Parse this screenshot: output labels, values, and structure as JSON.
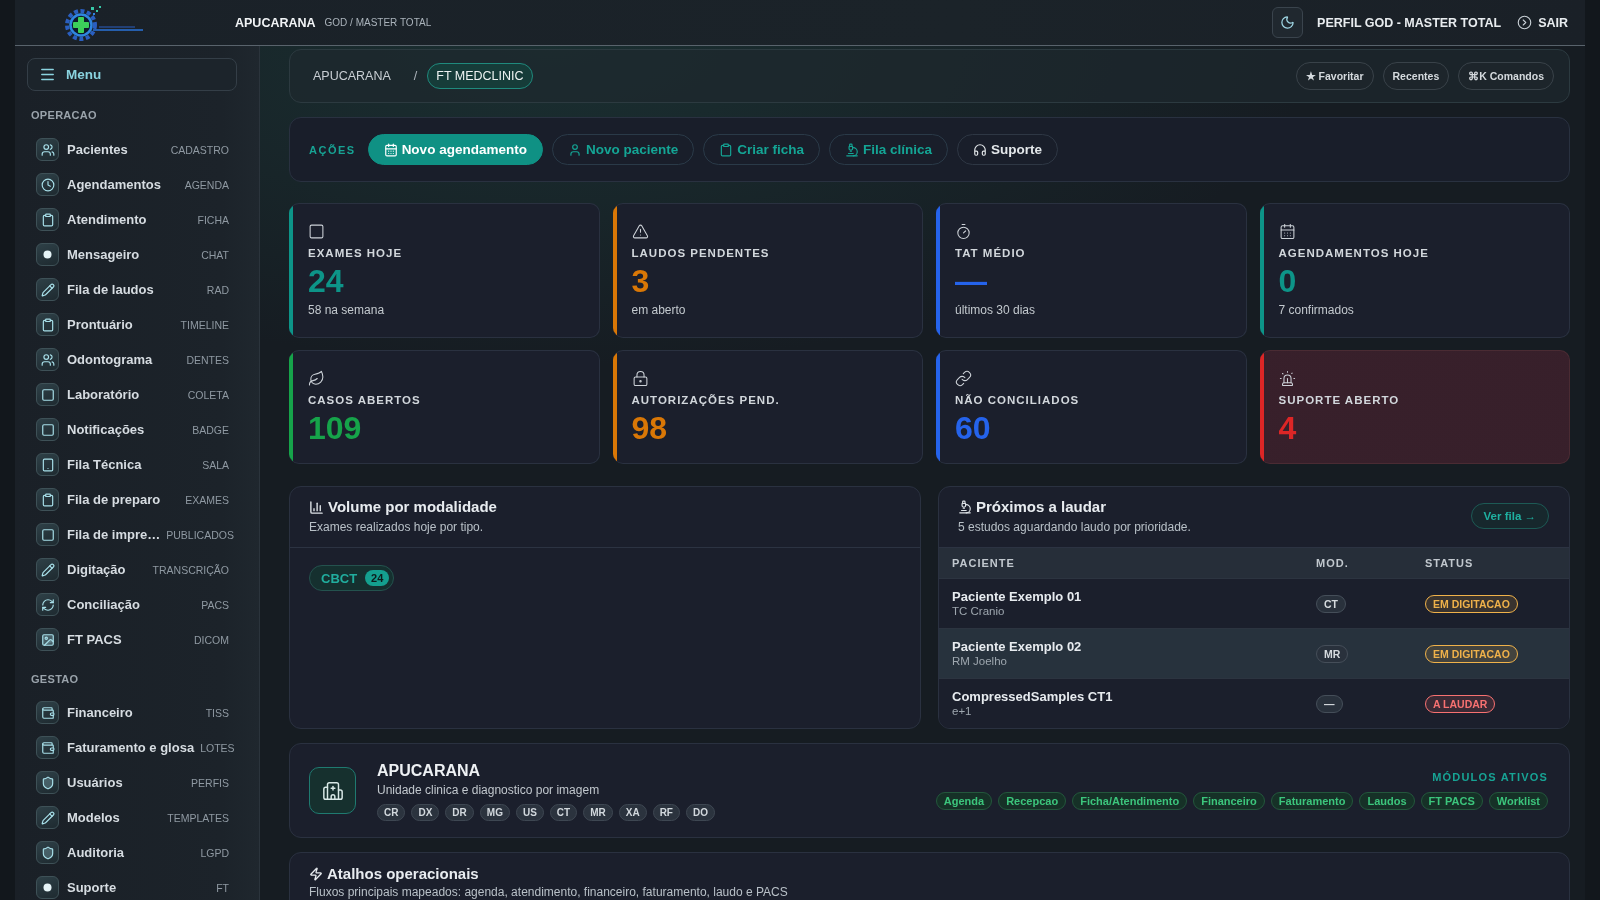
{
  "topbar": {
    "unit": "APUCARANA",
    "profile_path": "GOD / MASTER TOTAL",
    "profile": "PERFIL GOD - MASTER TOTAL",
    "logout": "SAIR"
  },
  "sidebar": {
    "menu": "Menu",
    "sections": [
      {
        "title": "OPERACAO",
        "items": [
          {
            "label": "Pacientes",
            "tag": "CADASTRO",
            "kind": "users"
          },
          {
            "label": "Agendamentos",
            "tag": "AGENDA",
            "kind": "clock"
          },
          {
            "label": "Atendimento",
            "tag": "FICHA",
            "kind": "clipboard"
          },
          {
            "label": "Mensageiro",
            "tag": "CHAT",
            "kind": "dot"
          },
          {
            "label": "Fila de laudos",
            "tag": "RAD",
            "kind": "pencil"
          },
          {
            "label": "Prontuário",
            "tag": "TIMELINE",
            "kind": "clipboard"
          },
          {
            "label": "Odontograma",
            "tag": "DENTES",
            "kind": "users"
          },
          {
            "label": "Laboratório",
            "tag": "COLETA",
            "kind": "square"
          },
          {
            "label": "Notificações",
            "tag": "BADGE",
            "kind": "square"
          },
          {
            "label": "Fila Técnica",
            "tag": "SALA",
            "kind": "tablet"
          },
          {
            "label": "Fila de preparo",
            "tag": "EXAMES",
            "kind": "clipboard"
          },
          {
            "label": "Fila de impre…",
            "tag": "PUBLICADOS",
            "kind": "square"
          },
          {
            "label": "Digitação",
            "tag": "TRANSCRIÇÃO",
            "kind": "pencil"
          },
          {
            "label": "Conciliação",
            "tag": "PACS",
            "kind": "refresh"
          },
          {
            "label": "FT PACS",
            "tag": "DICOM",
            "kind": "image"
          }
        ]
      },
      {
        "title": "GESTAO",
        "items": [
          {
            "label": "Financeiro",
            "tag": "TISS",
            "kind": "wallet"
          },
          {
            "label": "Faturamento e glosa",
            "tag": "LOTES",
            "kind": "wallet"
          },
          {
            "label": "Usuários",
            "tag": "PERFIS",
            "kind": "shield"
          },
          {
            "label": "Modelos",
            "tag": "TEMPLATES",
            "kind": "pencil"
          },
          {
            "label": "Auditoria",
            "tag": "LGPD",
            "kind": "shield"
          },
          {
            "label": "Suporte",
            "tag": "FT",
            "kind": "dot"
          }
        ]
      }
    ]
  },
  "breadcrumb": {
    "separator": "/",
    "items": [
      {
        "label": "APUCARANA",
        "selected": false
      },
      {
        "label": "FT MEDCLINIC",
        "selected": true
      }
    ]
  },
  "quick_buttons": [
    "★ Favoritar",
    "Recentes",
    "⌘K Comandos"
  ],
  "actions": {
    "label": "AÇÕES",
    "buttons": [
      {
        "label": "Novo agendamento",
        "kind": "primary"
      },
      {
        "label": "Novo paciente",
        "kind": "outline"
      },
      {
        "label": "Criar ficha",
        "kind": "outline"
      },
      {
        "label": "Fila clínica",
        "kind": "outline"
      },
      {
        "label": "Suporte",
        "kind": "plain"
      }
    ]
  },
  "stats": [
    {
      "label": "EXAMES HOJE",
      "value": "24",
      "note": "58 na semana",
      "kind": "square",
      "color": "#0d9488",
      "alert": false
    },
    {
      "label": "LAUDOS PENDENTES",
      "value": "3",
      "note": "em aberto",
      "kind": "warning",
      "color": "#d97706",
      "alert": false
    },
    {
      "label": "TAT MÉDIO",
      "value": "—",
      "note": "últimos 30 dias",
      "kind": "stopwatch",
      "color": "#2563eb",
      "alert": false
    },
    {
      "label": "AGENDAMENTOS HOJE",
      "value": "0",
      "note": "7 confirmados",
      "kind": "calendar",
      "color": "#0d9488",
      "alert": false
    },
    {
      "label": "CASOS ABERTOS",
      "value": "109",
      "kind": "leaf",
      "color": "#16a34a",
      "alert": false
    },
    {
      "label": "AUTORIZAÇÕES PEND.",
      "value": "98",
      "kind": "lock",
      "color": "#d97706",
      "alert": false
    },
    {
      "label": "NÃO CONCILIADOS",
      "value": "60",
      "kind": "link",
      "color": "#2563eb",
      "alert": false
    },
    {
      "label": "SUPORTE ABERTO",
      "value": "4",
      "kind": "siren",
      "color": "#dc2626",
      "alert": true
    }
  ],
  "volume": {
    "title": "Volume por modalidade",
    "subtitle": "Exames realizados hoje por tipo.",
    "chips": [
      {
        "label": "CBCT",
        "count": "24"
      }
    ]
  },
  "queue": {
    "title": "Próximos a laudar",
    "subtitle": "5 estudos aguardando laudo por prioridade.",
    "button": "Ver fila →",
    "columns": [
      "PACIENTE",
      "MOD.",
      "STATUS"
    ],
    "rows": [
      {
        "name": "Paciente Exemplo 01",
        "exam": "TC Cranio",
        "modality": "CT",
        "status": "EM DIGITACAO",
        "color": "#f0b24a",
        "selected": false
      },
      {
        "name": "Paciente Exemplo 02",
        "exam": "RM Joelho",
        "modality": "MR",
        "status": "EM DIGITACAO",
        "color": "#f0b24a",
        "selected": true
      },
      {
        "name": "CompressedSamples CT1",
        "exam": "e+1",
        "modality": "—",
        "status": "A LAUDAR",
        "color": "#f87171",
        "selected": false
      }
    ]
  },
  "unit_card": {
    "title": "APUCARANA",
    "subtitle": "Unidade clinica e diagnostico por imagem",
    "modalities": [
      "CR",
      "DX",
      "DR",
      "MG",
      "US",
      "CT",
      "MR",
      "XA",
      "RF",
      "DO"
    ],
    "modules_label": "MÓDULOS ATIVOS",
    "modules": [
      "Agenda",
      "Recepcao",
      "Ficha/Atendimento",
      "Financeiro",
      "Faturamento",
      "Laudos",
      "FT PACS",
      "Worklist"
    ]
  },
  "shortcuts": {
    "title": "Atalhos operacionais",
    "subtitle": "Fluxos principais mapeados: agenda, atendimento, financeiro, faturamento, laudo e PACS"
  }
}
